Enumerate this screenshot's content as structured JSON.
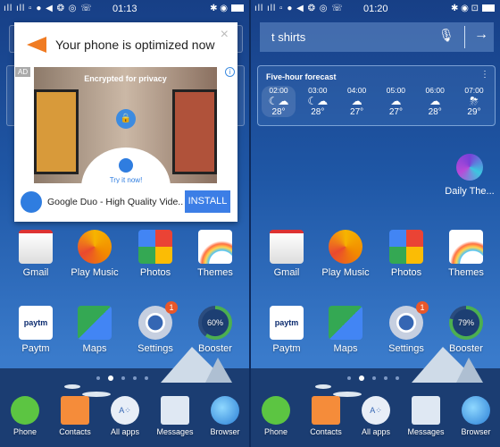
{
  "left": {
    "status": {
      "left_icons": "ıll ıll ▫ ● ◀ ❂ ◎ ☏",
      "time": "01:13",
      "right_icons": "✱ ◉"
    },
    "ad_popup": {
      "title": "Your phone is optimized now",
      "close": "×",
      "ad_label": "AD",
      "info": "i",
      "image_caption": "Encrypted for privacy",
      "image_cta": "Try it now!",
      "app_name": "Google Duo - High Quality Vide..",
      "install_label": "INSTALL"
    },
    "booster_percent": "60%"
  },
  "right": {
    "status": {
      "left_icons": "ıll ıll ▫ ● ◀ ❂ ◎ ☏",
      "time": "01:20",
      "right_icons": "✱ ◉ ⊡"
    },
    "search": {
      "query": "t shirts",
      "mic": "🎙",
      "go": "→"
    },
    "forecast": {
      "title": "Five-hour forecast",
      "more": "⋮",
      "hours": [
        {
          "time": "02:00",
          "icon": "partly-cloudy-night",
          "temp": "28°"
        },
        {
          "time": "03:00",
          "icon": "partly-cloudy-night",
          "temp": "28°"
        },
        {
          "time": "04:00",
          "icon": "cloudy",
          "temp": "27°"
        },
        {
          "time": "05:00",
          "icon": "cloudy",
          "temp": "27°"
        },
        {
          "time": "06:00",
          "icon": "cloudy",
          "temp": "28°"
        },
        {
          "time": "07:00",
          "icon": "thunderstorm",
          "temp": "29°"
        }
      ]
    },
    "daily_theme": "Daily The...",
    "booster_percent": "79%"
  },
  "apps": [
    "Gmail",
    "Play Music",
    "Photos",
    "Themes",
    "Paytm",
    "Maps",
    "Settings",
    "Booster"
  ],
  "settings_badge": "1",
  "paytm_logo": "paytm",
  "dock": [
    "Phone",
    "Contacts",
    "All apps",
    "Messages",
    "Browser"
  ],
  "colors": {
    "accent": "#3c7ee6",
    "badge": "#e8572a"
  }
}
